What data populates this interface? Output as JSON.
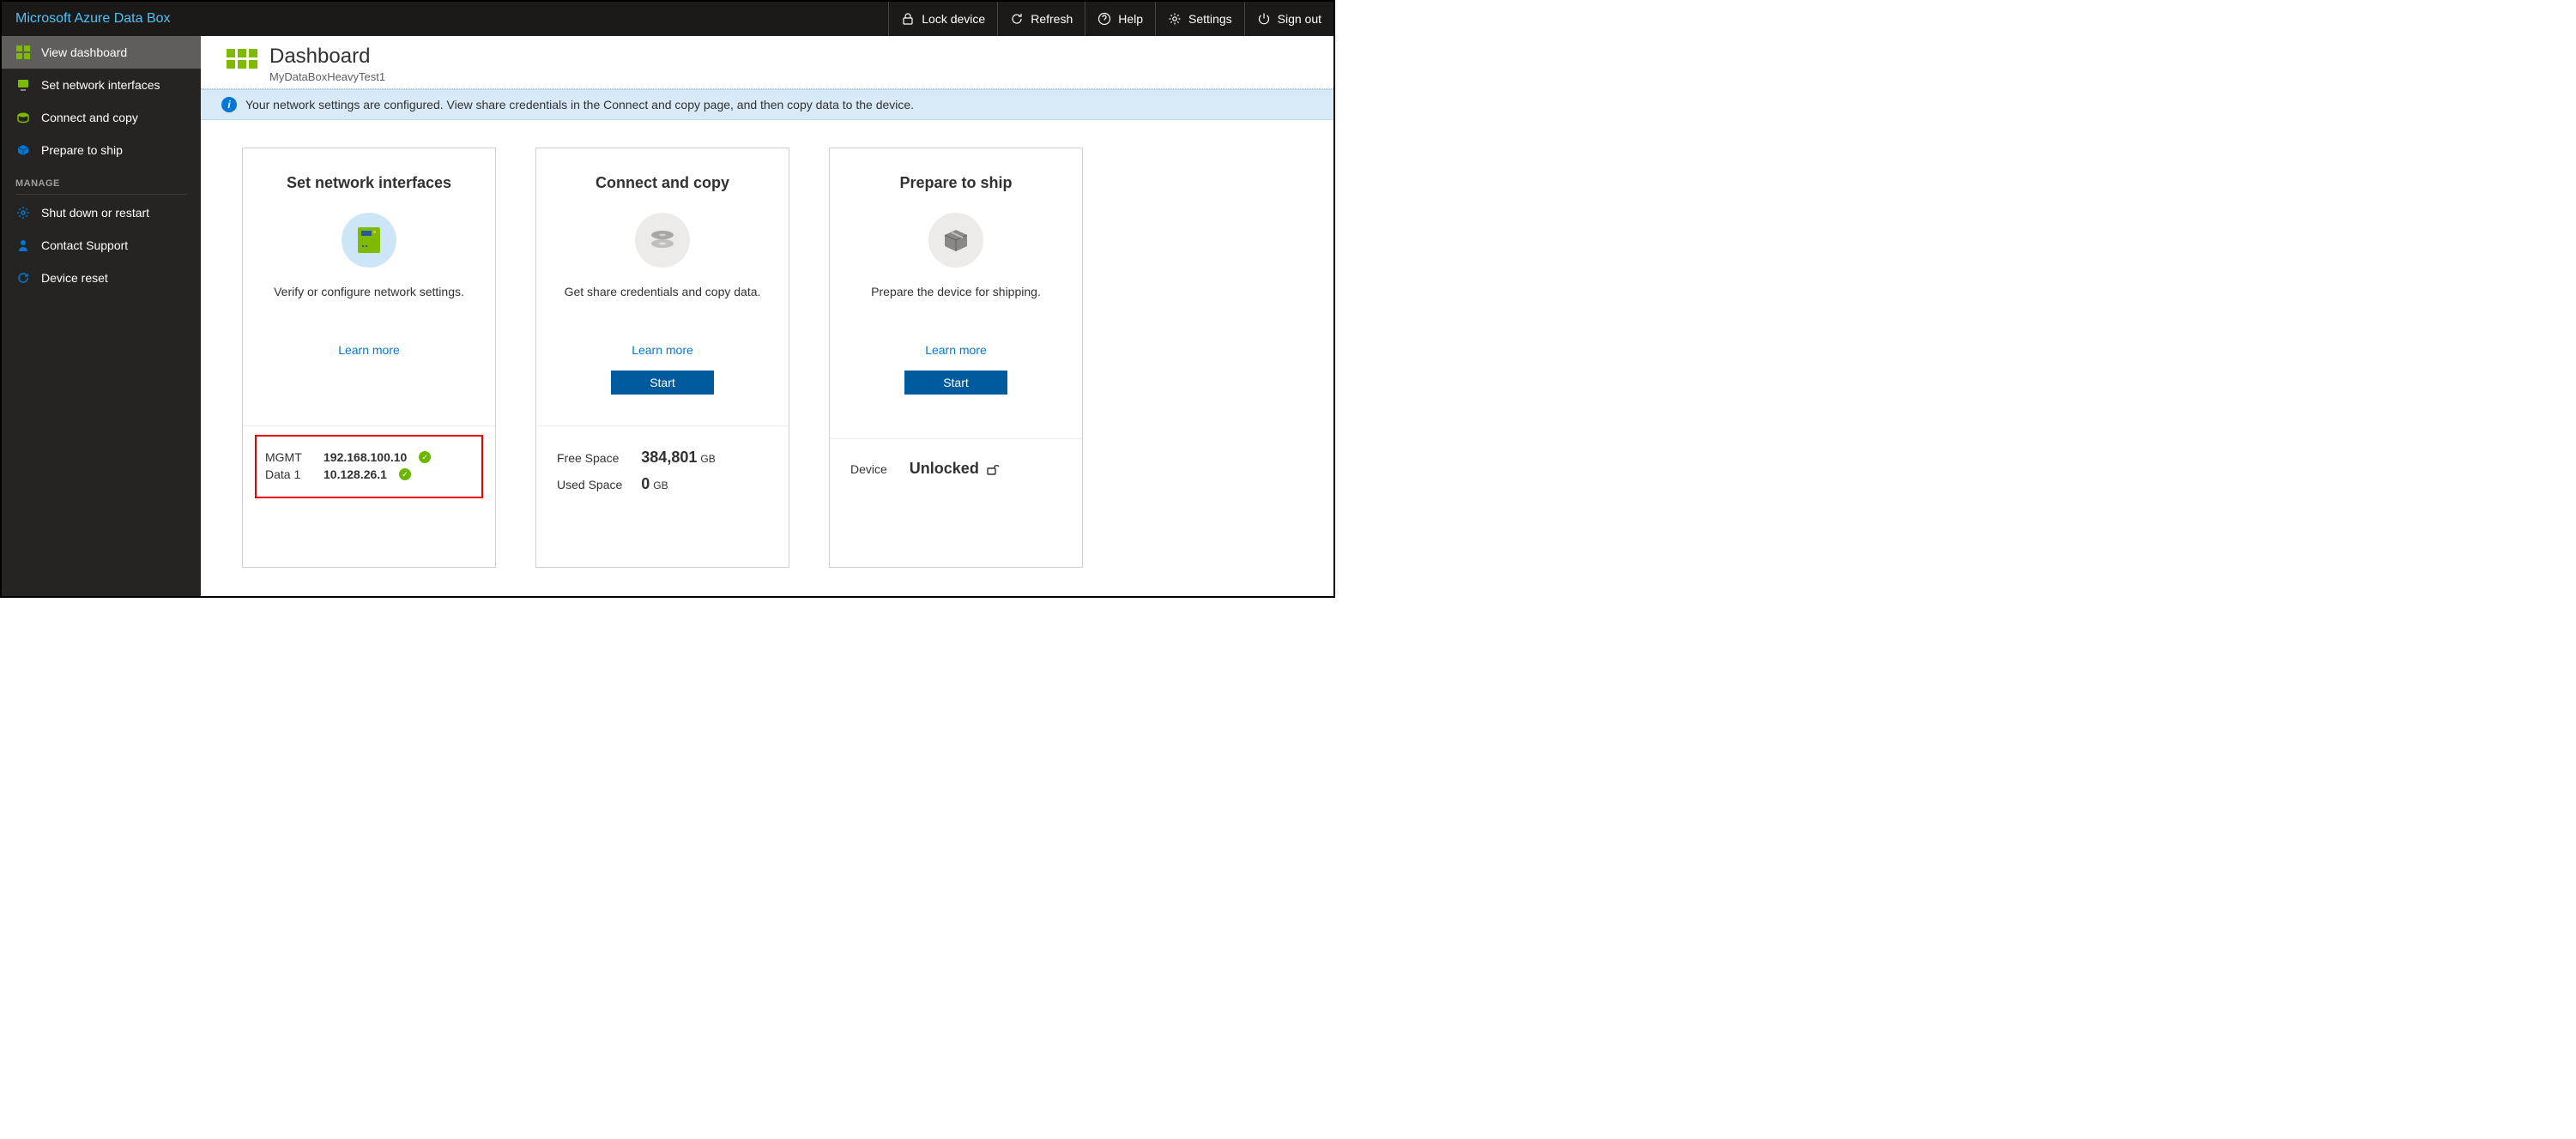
{
  "topbar": {
    "title": "Microsoft Azure Data Box",
    "lock": "Lock device",
    "refresh": "Refresh",
    "help": "Help",
    "settings": "Settings",
    "signout": "Sign out"
  },
  "sidebar": {
    "items": [
      "View dashboard",
      "Set network interfaces",
      "Connect and copy",
      "Prepare to ship"
    ],
    "manage_header": "MANAGE",
    "manage_items": [
      "Shut down or restart",
      "Contact Support",
      "Device reset"
    ]
  },
  "page": {
    "title": "Dashboard",
    "subtitle": "MyDataBoxHeavyTest1",
    "info": "Your network settings are configured. View share credentials in the Connect and copy page, and then copy data to the device."
  },
  "cards": {
    "network": {
      "title": "Set network interfaces",
      "desc": "Verify or configure network settings.",
      "learn": "Learn more",
      "rows": [
        {
          "label": "MGMT",
          "value": "192.168.100.10"
        },
        {
          "label": "Data 1",
          "value": "10.128.26.1"
        }
      ]
    },
    "copy": {
      "title": "Connect and copy",
      "desc": "Get share credentials and copy data.",
      "learn": "Learn more",
      "start": "Start",
      "free_label": "Free Space",
      "free_value": "384,801",
      "free_unit": "GB",
      "used_label": "Used Space",
      "used_value": "0",
      "used_unit": "GB"
    },
    "ship": {
      "title": "Prepare to ship",
      "desc": "Prepare the device for shipping.",
      "learn": "Learn more",
      "start": "Start",
      "device_label": "Device",
      "device_value": "Unlocked"
    }
  }
}
